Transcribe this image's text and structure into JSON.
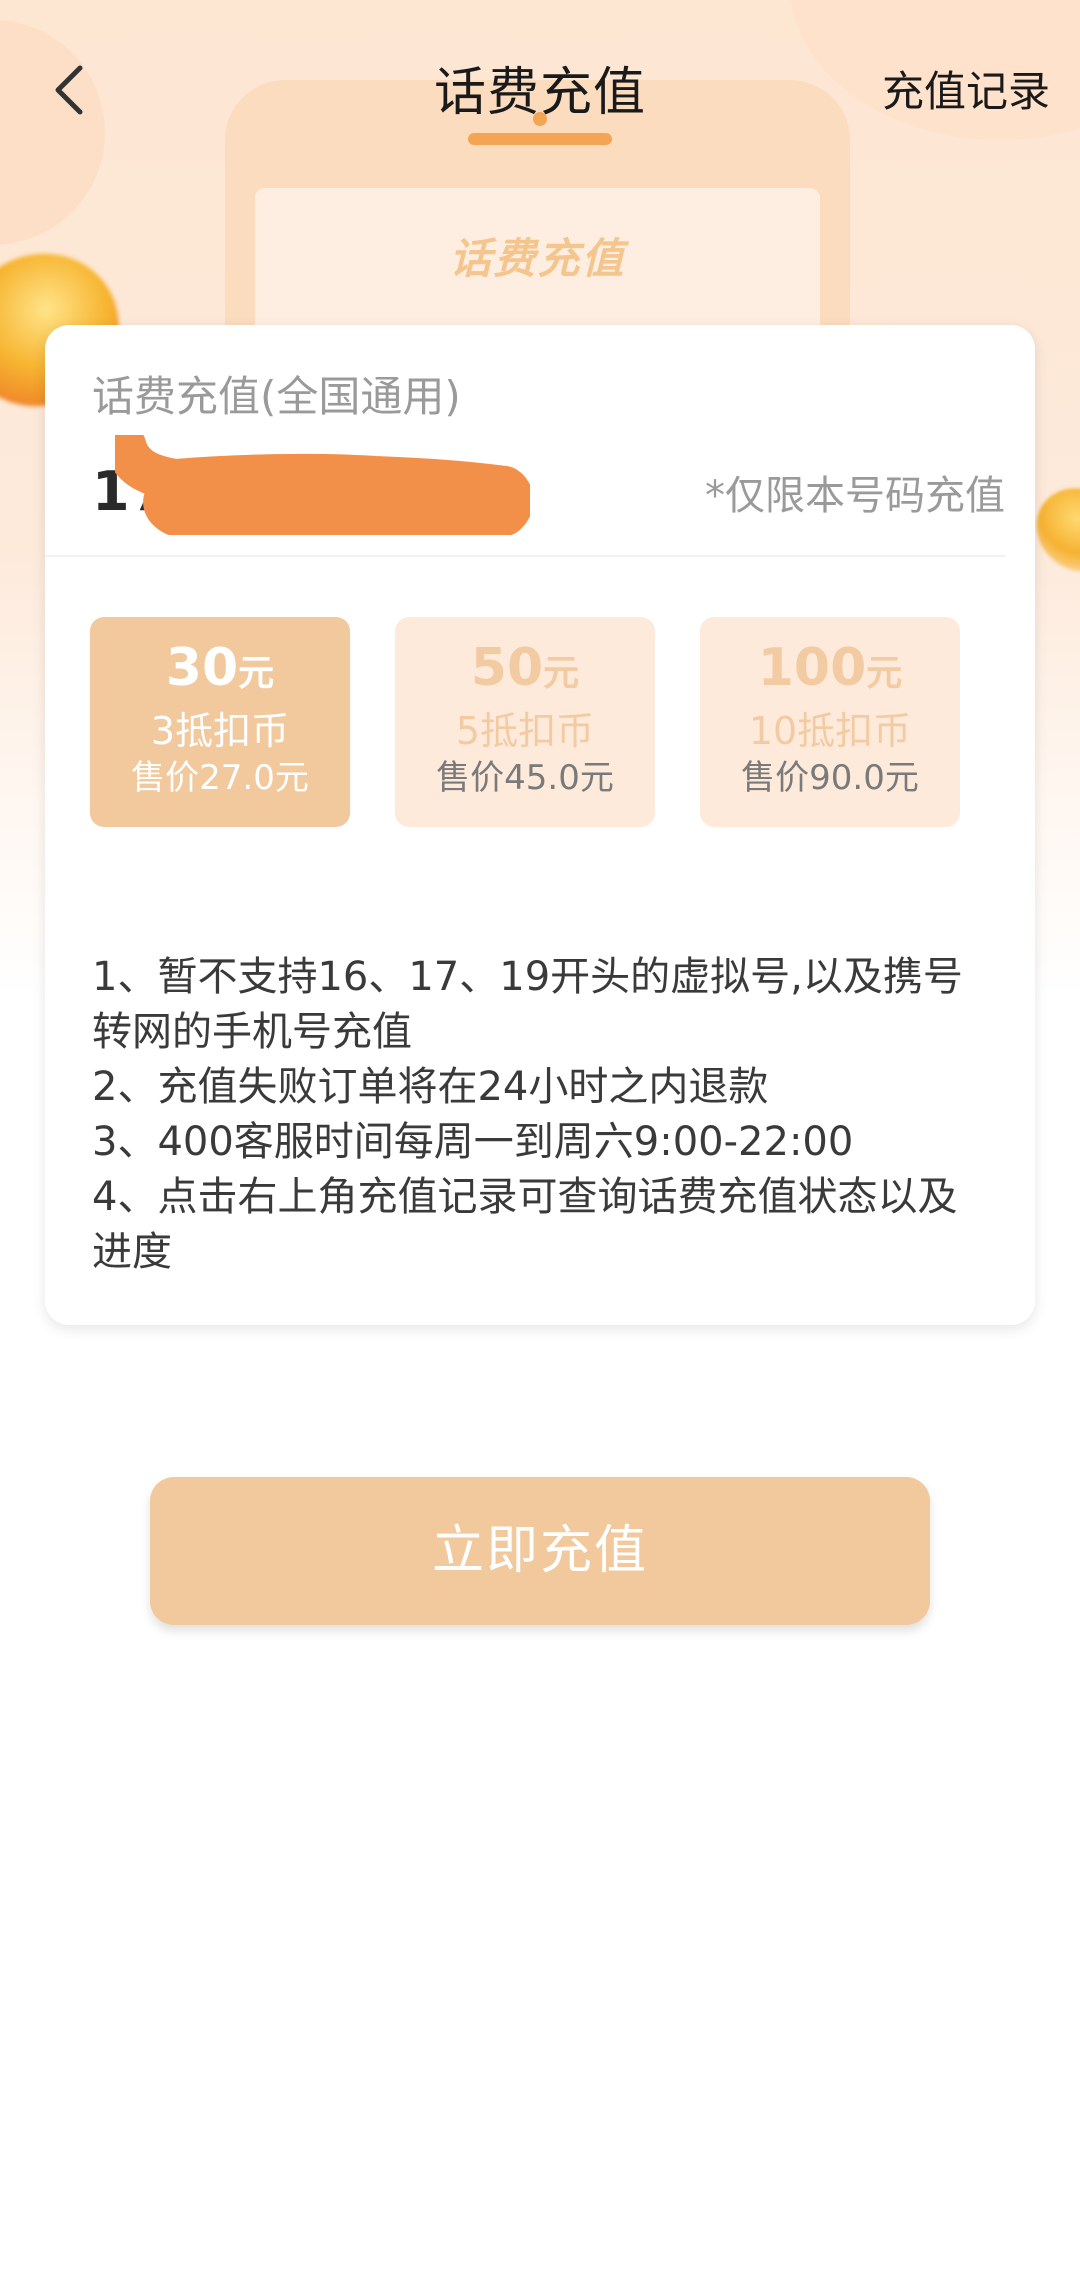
{
  "header": {
    "title": "话费充值",
    "history_link": "充值记录",
    "back_icon": "chevron-left-icon"
  },
  "banner": {
    "phone_screen_text": "话费充值"
  },
  "card": {
    "title": "话费充值(全国通用)",
    "phone_number_visible": "17",
    "limit_note": "*仅限本号码充值"
  },
  "options": [
    {
      "amount": "30",
      "unit": "元",
      "coin": "3抵扣币",
      "price": "售价27.0元",
      "selected": true
    },
    {
      "amount": "50",
      "unit": "元",
      "coin": "5抵扣币",
      "price": "售价45.0元",
      "selected": false
    },
    {
      "amount": "100",
      "unit": "元",
      "coin": "10抵扣币",
      "price": "售价90.0元",
      "selected": false
    }
  ],
  "notes": [
    "1、暂不支持16、17、19开头的虚拟号,以及携号转网的手机号充值",
    "2、充值失败订单将在24小时之内退款",
    "3、400客服时间每周一到周六9:00-22:00",
    "4、点击右上角充值记录可查询话费充值状态以及进度"
  ],
  "submit_button": "立即充值",
  "colors": {
    "accent": "#f4a554",
    "selected_option": "#f1c99d",
    "unselected_option": "#fdeadb",
    "button": "#f1c99d",
    "redaction": "#f2904a"
  }
}
